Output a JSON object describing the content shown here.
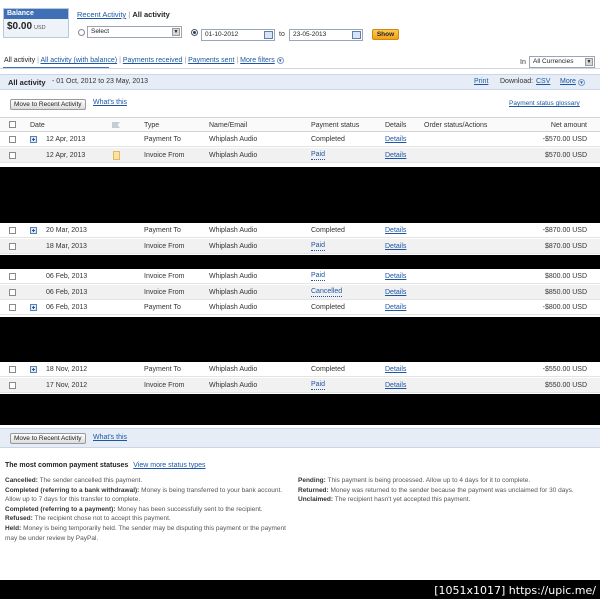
{
  "balance": {
    "label": "Balance",
    "amount": "$0.00",
    "currency": "USD"
  },
  "nav": {
    "recent": "Recent Activity",
    "separator": "|",
    "current": "All activity"
  },
  "filter": {
    "select_value": "Select",
    "from_date": "01-10-2012",
    "to_label": "to",
    "to_date": "23-05-2013",
    "show_label": "Show"
  },
  "tabs": {
    "all": "All activity",
    "all_with_balance": "All activity (with balance)",
    "received": "Payments received",
    "sent": "Payments sent",
    "more_filters": "More filters",
    "sep": "|"
  },
  "currency": {
    "in_label": "In",
    "value": "All Currencies"
  },
  "title_bar": {
    "title": "All activity",
    "range": "- 01 Oct, 2012 to 23 May, 2013",
    "print": "Print",
    "download_label": "Download:",
    "csv": "CSV",
    "more": "More"
  },
  "toolbar": {
    "move_button": "Move to Recent Activity",
    "whats_this": "What's this",
    "glossary": "Payment status glossary"
  },
  "columns": {
    "date": "Date",
    "type": "Type",
    "name": "Name/Email",
    "status": "Payment status",
    "details": "Details",
    "order": "Order status/Actions",
    "amount": "Net amount"
  },
  "groups": [
    {
      "rows": [
        {
          "date": "12 Apr, 2013",
          "icon": "plus",
          "type": "Payment To",
          "name": "Whiplash Audio",
          "status": "Completed",
          "status_link": false,
          "details": "Details",
          "amount": "-$570.00 USD"
        },
        {
          "date": "12 Apr, 2013",
          "icon": "doc",
          "type": "Invoice From",
          "name": "Whiplash Audio",
          "status": "Paid",
          "status_link": true,
          "details": "Details",
          "amount": "$570.00 USD"
        }
      ]
    },
    {
      "rows": [
        {
          "date": "20 Mar, 2013",
          "icon": "plus",
          "type": "Payment To",
          "name": "Whiplash Audio",
          "status": "Completed",
          "status_link": false,
          "details": "Details",
          "amount": "-$870.00 USD"
        },
        {
          "date": "18 Mar, 2013",
          "icon": "",
          "type": "Invoice From",
          "name": "Whiplash Audio",
          "status": "Paid",
          "status_link": true,
          "details": "Details",
          "amount": "$870.00 USD"
        }
      ]
    },
    {
      "rows": [
        {
          "date": "06 Feb, 2013",
          "icon": "",
          "type": "Invoice From",
          "name": "Whiplash Audio",
          "status": "Paid",
          "status_link": true,
          "details": "Details",
          "amount": "$800.00 USD"
        },
        {
          "date": "06 Feb, 2013",
          "icon": "",
          "type": "Invoice From",
          "name": "Whiplash Audio",
          "status": "Cancelled",
          "status_link": true,
          "details": "Details",
          "amount": "$850.00 USD"
        },
        {
          "date": "06 Feb, 2013",
          "icon": "plus",
          "type": "Payment To",
          "name": "Whiplash Audio",
          "status": "Completed",
          "status_link": false,
          "details": "Details",
          "amount": "-$800.00 USD"
        }
      ]
    },
    {
      "rows": [
        {
          "date": "18 Nov, 2012",
          "icon": "plus",
          "type": "Payment To",
          "name": "Whiplash Audio",
          "status": "Completed",
          "status_link": false,
          "details": "Details",
          "amount": "-$550.00 USD"
        },
        {
          "date": "17 Nov, 2012",
          "icon": "",
          "type": "Invoice From",
          "name": "Whiplash Audio",
          "status": "Paid",
          "status_link": true,
          "details": "Details",
          "amount": "$550.00 USD"
        }
      ]
    }
  ],
  "footer": {
    "move_button": "Move to Recent Activity",
    "whats_this": "What's this",
    "statuses_title": "The most common payment statuses",
    "view_more": "View more status types",
    "left": [
      {
        "term": "Cancelled:",
        "text": "The sender cancelled this payment."
      },
      {
        "term": "Completed (referring to a bank withdrawal):",
        "text": "Money is being transferred to your bank account. Allow up to 7 days for this transfer to complete."
      },
      {
        "term": "Completed (referring to a payment):",
        "text": "Money has been successfully sent to the recipient."
      },
      {
        "term": "Refused:",
        "text": "The recipient chose not to accept this payment."
      },
      {
        "term": "Held:",
        "text": "Money is being temporarily held. The sender may be disputing this payment or the payment may be under review by PayPal."
      }
    ],
    "right": [
      {
        "term": "Pending:",
        "text": "This payment is being processed. Allow up to 4 days for it to complete."
      },
      {
        "term": "Returned:",
        "text": "Money was returned to the sender because the payment was unclaimed for 30 days."
      },
      {
        "term": "Unclaimed:",
        "text": "The recipient hasn't yet accepted this payment."
      }
    ]
  },
  "watermark": "[1051x1017] https://upic.me/"
}
